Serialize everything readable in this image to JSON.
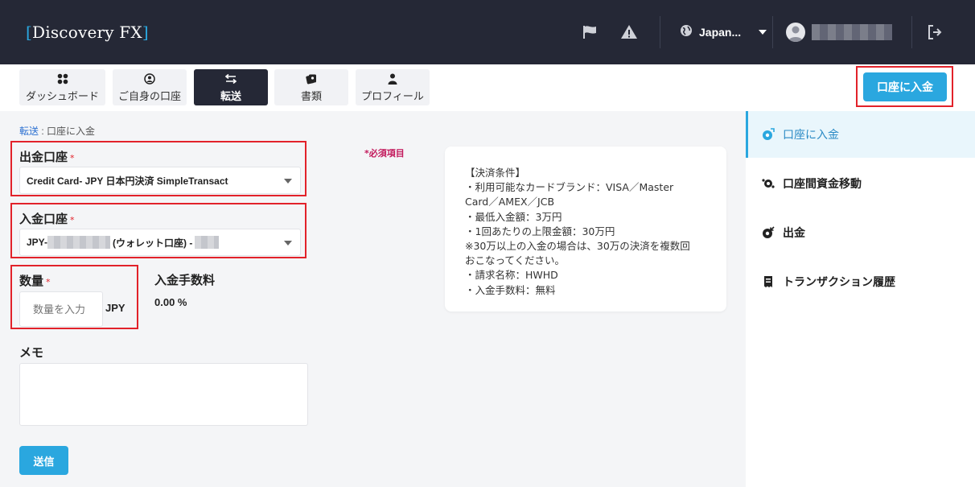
{
  "app": {
    "logo": "Discovery FX"
  },
  "header": {
    "language": "Japan..."
  },
  "nav": {
    "tabs": [
      {
        "label": "ダッシュボード",
        "icon": "grid-icon"
      },
      {
        "label": "ご自身の口座",
        "icon": "user-circle-icon"
      },
      {
        "label": "転送",
        "icon": "transfer-arrows-icon"
      },
      {
        "label": "書類",
        "icon": "documents-icon"
      },
      {
        "label": "プロフィール",
        "icon": "person-icon"
      }
    ],
    "active_tab": "転送",
    "deposit_button": "口座に入金"
  },
  "breadcrumb": {
    "parent": "転送",
    "separator": " : ",
    "current": "口座に入金"
  },
  "form": {
    "required_note": "*必須項目",
    "from_account": {
      "label": "出金口座",
      "star": "*",
      "value": "Credit Card- JPY 日本円決済 SimpleTransact"
    },
    "to_account": {
      "label": "入金口座",
      "star": "*",
      "prefix": "JPY-",
      "middle": "(ウォレット口座) -"
    },
    "quantity": {
      "label": "数量",
      "star": "*",
      "placeholder": "数量を入力",
      "unit": "JPY"
    },
    "fee": {
      "label": "入金手数料",
      "value": "0.00 %"
    },
    "memo": {
      "label": "メモ"
    },
    "submit": "送信"
  },
  "info_box": {
    "lines": [
      "【決済条件】",
      "・利用可能なカードブランド：VISA／Master",
      "Card／AMEX／JCB",
      "・最低入金額：3万円",
      "・1回あたりの上限金額：30万円",
      "※30万以上の入金の場合は、30万の決済を複数回",
      "おこなってください。",
      "・請求名称：HWHD",
      "・入金手数料：無料"
    ]
  },
  "sidebar": {
    "items": [
      {
        "label": "口座に入金",
        "icon": "deposit-coin-icon",
        "active": true
      },
      {
        "label": "口座間資金移動",
        "icon": "internal-transfer-icon",
        "active": false
      },
      {
        "label": "出金",
        "icon": "withdraw-coin-icon",
        "active": false
      },
      {
        "label": "トランザクション履歴",
        "icon": "history-receipt-icon",
        "active": false
      }
    ]
  },
  "colors": {
    "header_bg": "#252836",
    "accent": "#2aa7df",
    "highlight_border": "#e2222a"
  }
}
